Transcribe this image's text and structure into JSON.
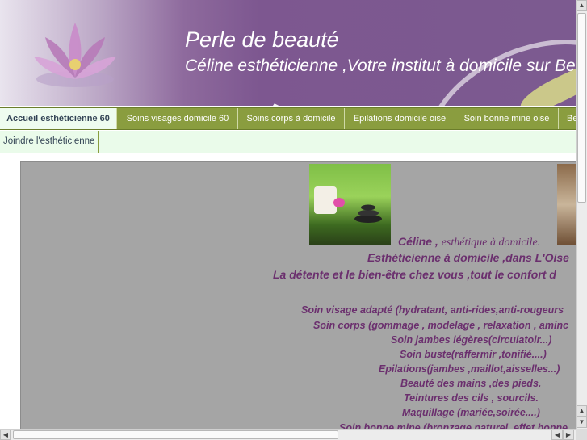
{
  "header": {
    "title": "Perle de beauté",
    "subtitle": "Céline esthéticienne ,Votre institut à domicile sur Bea"
  },
  "nav": {
    "tabs": [
      {
        "label": "Accueil esthéticienne 60"
      },
      {
        "label": "Soins visages domicile 60"
      },
      {
        "label": "Soins corps à domicile"
      },
      {
        "label": "Epilations domicile oise"
      },
      {
        "label": "Soin bonne mine oise"
      },
      {
        "label": "Be"
      }
    ]
  },
  "subnav": {
    "tabs": [
      {
        "label": "Joindre l'esthéticienne"
      }
    ]
  },
  "content": {
    "intro_name": "Céline ,",
    "intro_tag": "esthétique à domicile.",
    "line1": "Esthéticienne à domicile ,dans L'Oise",
    "line2": "La détente et le bien-être chez vous ,tout le confort d",
    "services": [
      "Soin visage adapté (hydratant, anti-rides,anti-rougeurs",
      "Soin corps (gommage , modelage , relaxation , aminc",
      "Soin jambes légères(circulatoir...)",
      "Soin buste(raffermir ,tonifié....)",
      "Epilations(jambes  ,maillot,aisselles...)",
      "Beauté des mains ,des pieds.",
      "Teintures des cils , sourcils.",
      "Maquillage (mariée,soirée....)",
      "Soin bonne mine (bronzage naturel ,effet bonne"
    ]
  },
  "colors": {
    "banner": "#7d5790",
    "nav": "#8a9d3f",
    "text": "#6b2f6e",
    "content_bg": "#a5a5a5"
  }
}
